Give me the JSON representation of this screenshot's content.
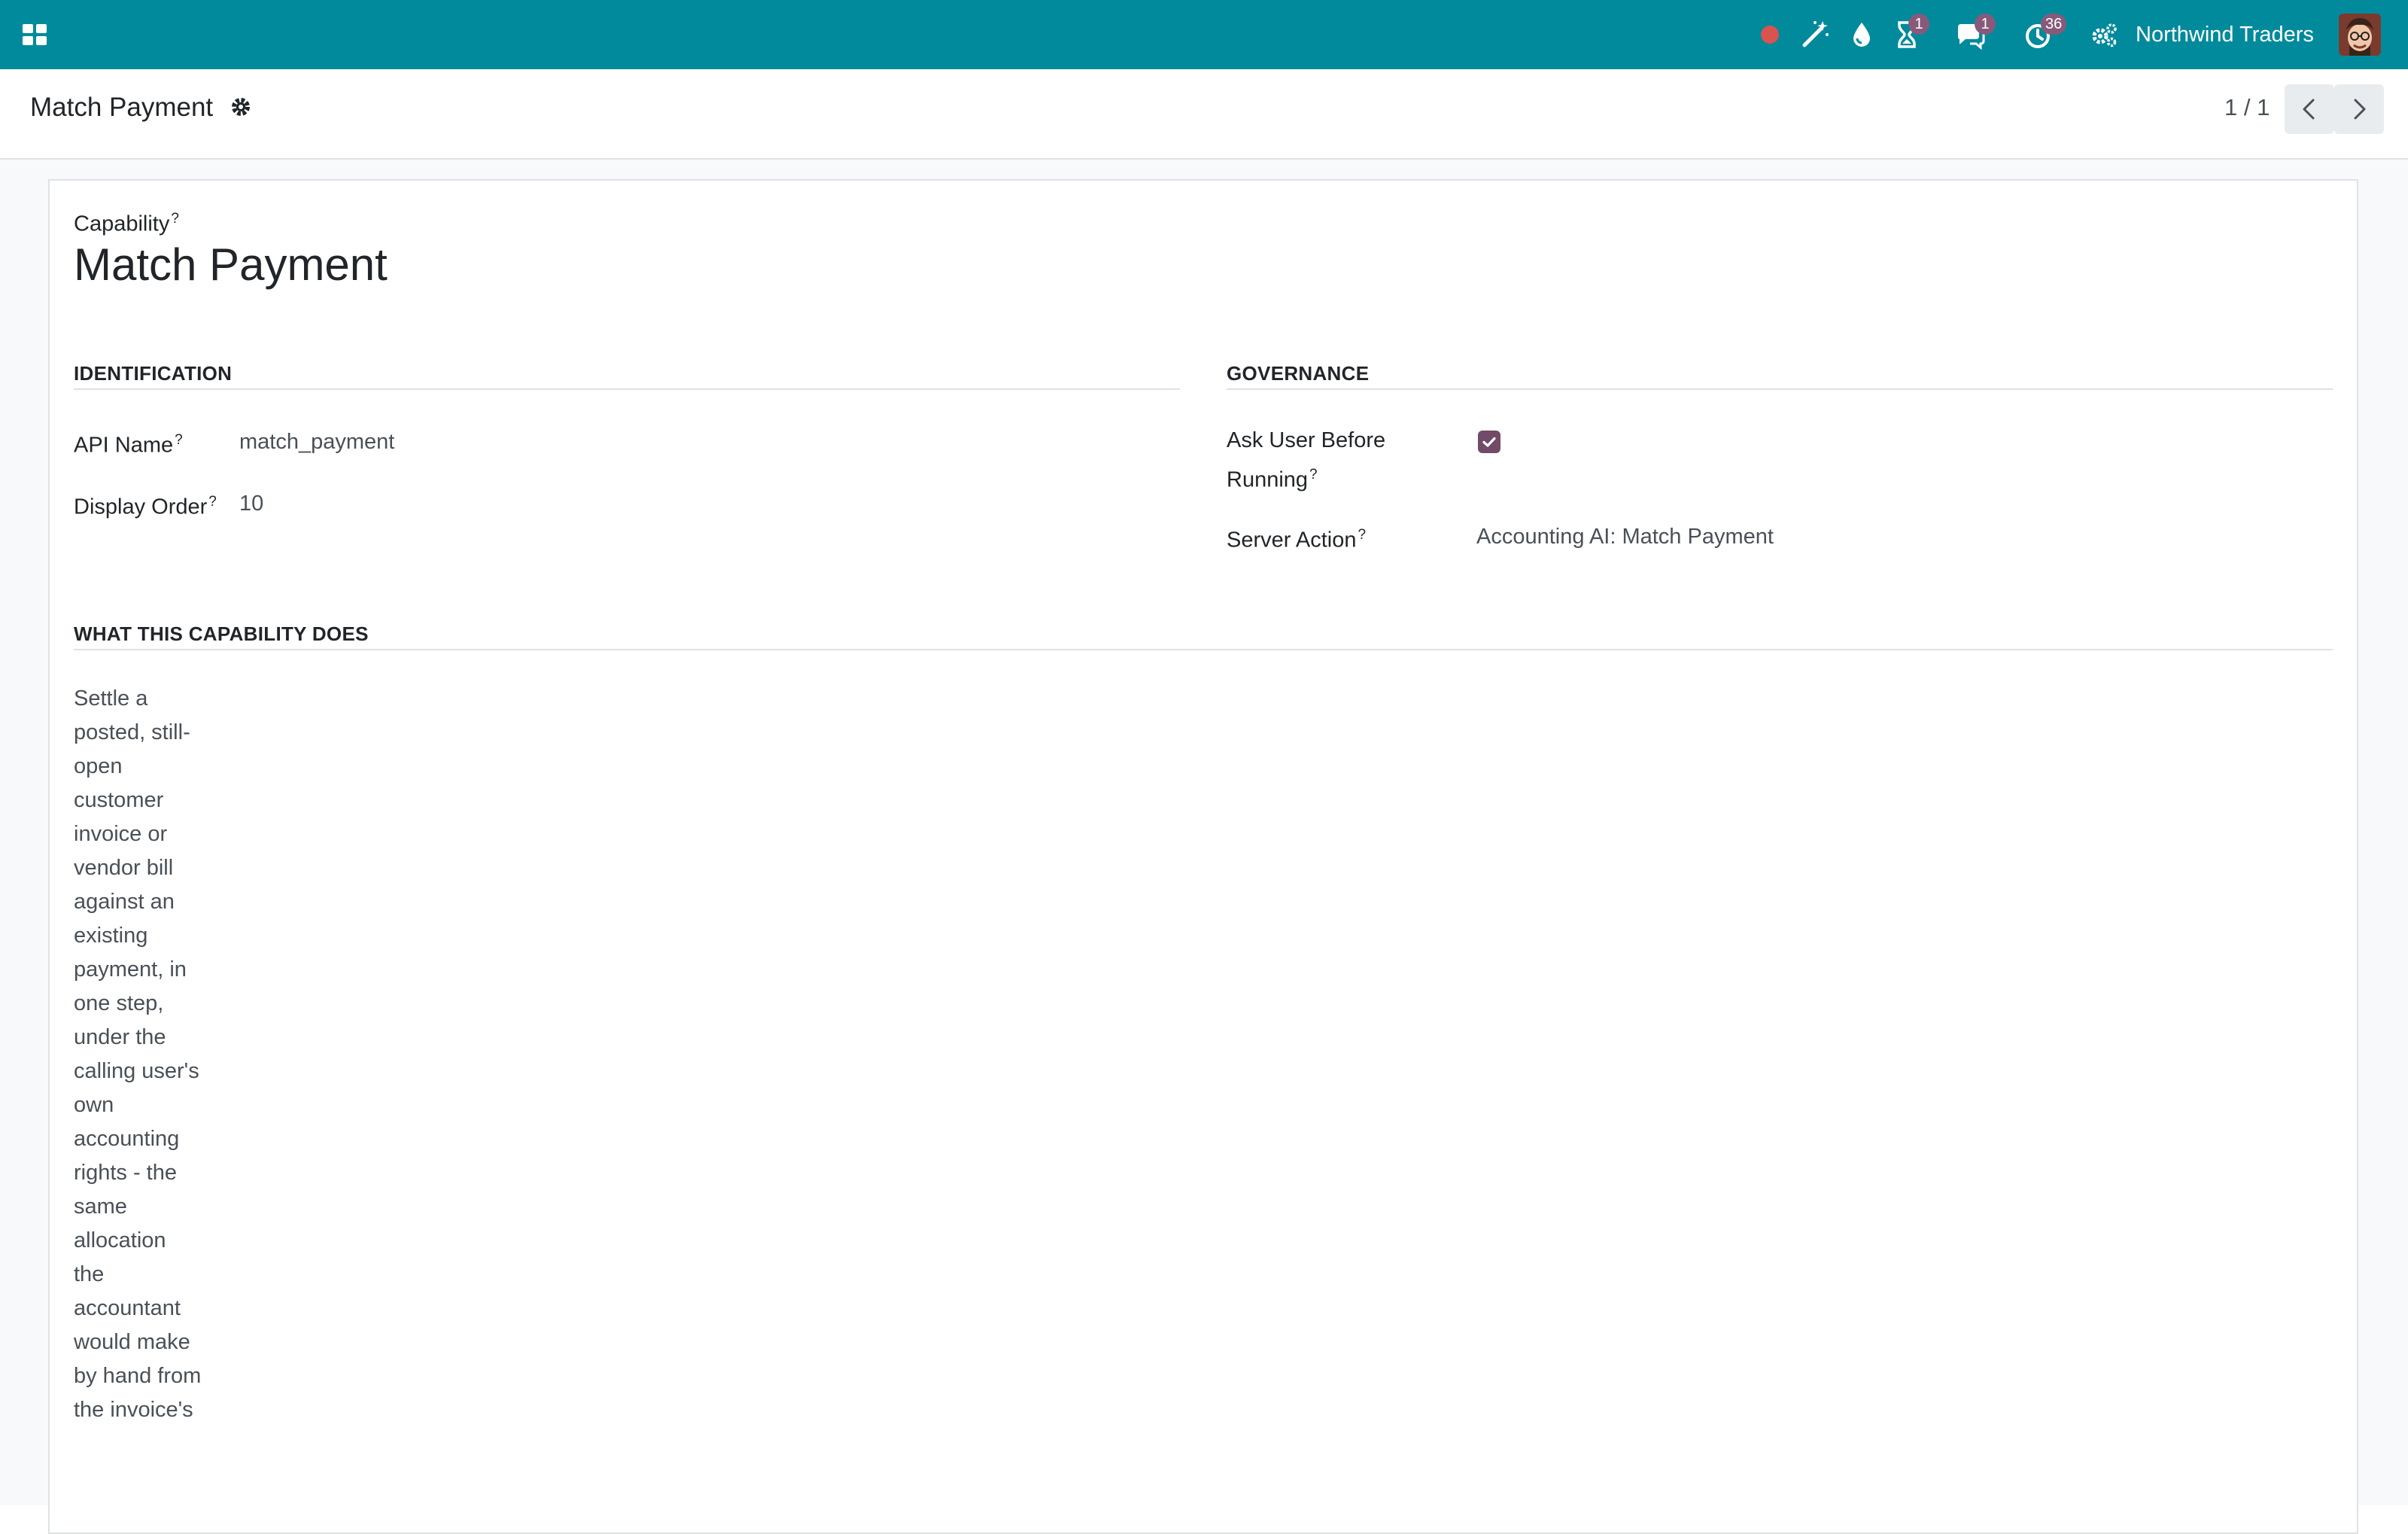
{
  "navbar": {
    "company": "Northwind Traders",
    "badges": {
      "activity": "1",
      "messages": "1",
      "timer": "36"
    },
    "colors": {
      "bar": "#018a9b",
      "badge": "#875a7b",
      "record_dot": "#d9534f"
    }
  },
  "control_panel": {
    "breadcrumb": "Match Payment",
    "pager": "1 / 1"
  },
  "form": {
    "capability_label": "Capability",
    "tooltip_mark": "?",
    "title": "Match Payment",
    "identification": {
      "heading": "IDENTIFICATION",
      "api_name_label": "API Name",
      "api_name_value": "match_payment",
      "display_order_label": "Display Order",
      "display_order_value": "10"
    },
    "governance": {
      "heading": "GOVERNANCE",
      "ask_user_label_line1": "Ask User Before",
      "ask_user_label_line2": "Running",
      "ask_user_checked": true,
      "server_action_label": "Server Action",
      "server_action_value": "Accounting AI: Match Payment"
    },
    "description": {
      "heading": "WHAT THIS CAPABILITY DOES",
      "text": "Settle a posted, still-open customer invoice or vendor bill against an existing payment, in one step, under the calling user's own accounting rights - the same allocation the accountant would make by hand from the invoice's"
    }
  }
}
